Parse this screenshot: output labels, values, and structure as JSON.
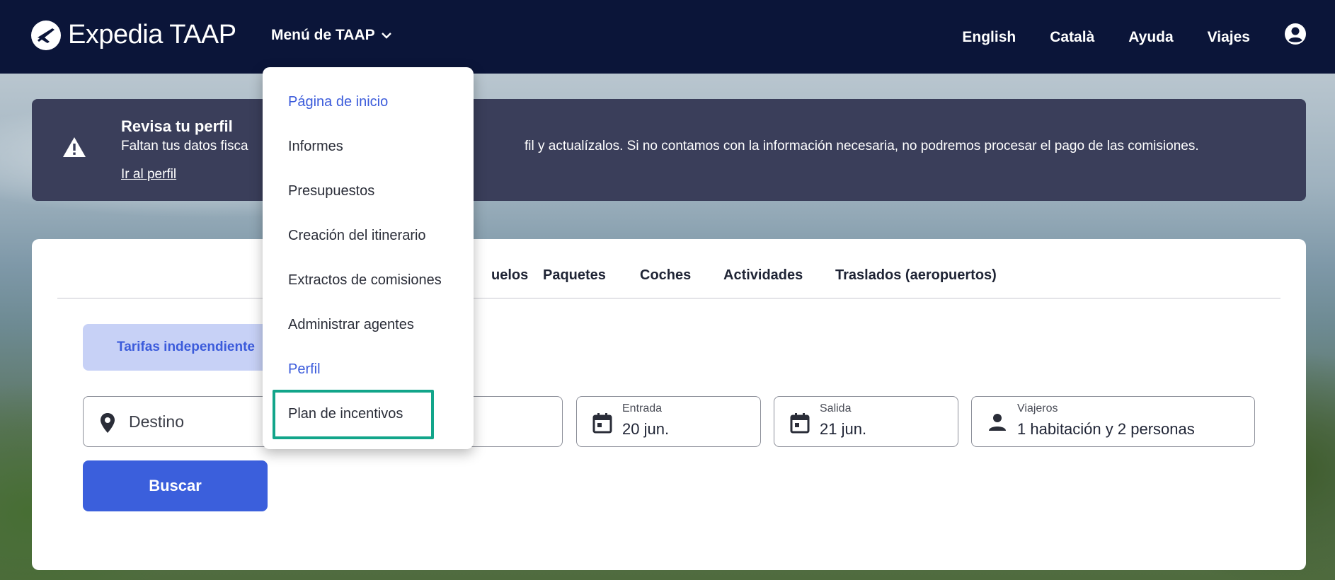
{
  "header": {
    "brand": "Expedia TAAP",
    "menu_label": "Menú de TAAP",
    "nav_links": [
      "English",
      "Català",
      "Ayuda",
      "Viajes"
    ],
    "icons": {
      "logo": "plane-logo-icon",
      "menu_chevron": "chevron-down-icon",
      "account": "account-circle-icon"
    }
  },
  "alert": {
    "title": "Revisa tu perfil",
    "message": "Faltan tus datos fiscales. Ve a tu perfil y actualízalos. Si no contamos con la información necesaria, no podremos procesar el pago de las comisiones.",
    "message_visible_left": "Faltan tus datos fisca",
    "message_visible_right": "fil y actualízalos. Si no contamos con la información necesaria, no podremos procesar el pago de las comisiones.",
    "link": "Ir al perfil",
    "icon": "warning-icon"
  },
  "dropdown": {
    "items": [
      {
        "label": "Página de inicio",
        "style": "link"
      },
      {
        "label": "Informes",
        "style": "normal"
      },
      {
        "label": "Presupuestos",
        "style": "normal"
      },
      {
        "label": "Creación del itinerario",
        "style": "normal"
      },
      {
        "label": "Extractos de comisiones",
        "style": "normal"
      },
      {
        "label": "Administrar agentes",
        "style": "normal"
      },
      {
        "label": "Perfil",
        "style": "link"
      },
      {
        "label": "Plan de incentivos",
        "style": "highlighted"
      }
    ],
    "highlight_color": "#12a58a"
  },
  "search": {
    "tabs": [
      "uelos",
      "Paquetes",
      "Coches",
      "Actividades",
      "Traslados (aeropuertos)"
    ],
    "tarifas_label": "Tarifas independiente",
    "destination_placeholder": "Destino",
    "checkin": {
      "label": "Entrada",
      "value": "20 jun."
    },
    "checkout": {
      "label": "Salida",
      "value": "21 jun."
    },
    "travelers": {
      "label": "Viajeros",
      "value": "1 habitación y 2 personas"
    },
    "search_button": "Buscar",
    "icons": {
      "destination": "location-pin-icon",
      "checkin": "calendar-icon",
      "checkout": "calendar-icon",
      "travelers": "person-icon"
    }
  },
  "colors": {
    "topbar": "#0b1539",
    "alert_bg": "#3a3e5a",
    "primary": "#3b5fdc",
    "chip_bg": "#c7d1f6"
  }
}
